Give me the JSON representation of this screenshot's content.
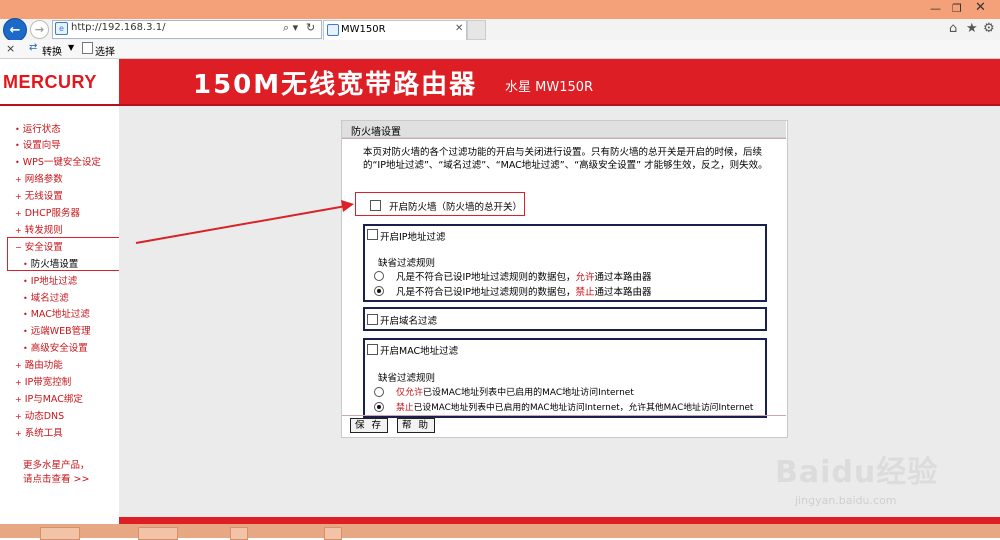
{
  "browser": {
    "url": "http://192.168.3.1/",
    "tab_title": "MW150R",
    "toolbar": {
      "close_glyph": "×",
      "convert_label": "转换",
      "select_label": "选择"
    },
    "icons": [
      "back-arrow-icon",
      "forward-arrow-icon",
      "search-icon",
      "refresh-icon",
      "home-icon",
      "star-icon",
      "gear-icon"
    ]
  },
  "header": {
    "logo": "MERCURY",
    "product_title": "150M无线宽带路由器",
    "model": "水星 MW150R"
  },
  "sidebar": {
    "items": [
      {
        "label": "运行状态",
        "bullet": "•"
      },
      {
        "label": "设置向导",
        "bullet": "•"
      },
      {
        "label": "WPS一键安全设定",
        "bullet": "•"
      },
      {
        "label": "网络参数",
        "bullet": "+"
      },
      {
        "label": "无线设置",
        "bullet": "+"
      },
      {
        "label": "DHCP服务器",
        "bullet": "+"
      },
      {
        "label": "转发规则",
        "bullet": "+"
      },
      {
        "label": "安全设置",
        "bullet": "−"
      },
      {
        "label": "防火墙设置",
        "bullet": "•"
      },
      {
        "label": "IP地址过滤",
        "bullet": "•"
      },
      {
        "label": "域名过滤",
        "bullet": "•"
      },
      {
        "label": "MAC地址过滤",
        "bullet": "•"
      },
      {
        "label": "远端WEB管理",
        "bullet": "•"
      },
      {
        "label": "高级安全设置",
        "bullet": "•"
      },
      {
        "label": "路由功能",
        "bullet": "+"
      },
      {
        "label": "IP带宽控制",
        "bullet": "+"
      },
      {
        "label": "IP与MAC绑定",
        "bullet": "+"
      },
      {
        "label": "动态DNS",
        "bullet": "+"
      },
      {
        "label": "系统工具",
        "bullet": "+"
      }
    ],
    "more_line1": "更多水星产品，",
    "more_line2": "请点击查看 >>"
  },
  "panel": {
    "title": "防火墙设置",
    "intro": "本页对防火墙的各个过滤功能的开启与关闭进行设置。只有防火墙的总开关是开启的时候，后续的“IP地址过滤”、“域名过滤”、“MAC地址过滤”、“高级安全设置” 才能够生效，反之，则失效。",
    "firewall_master": {
      "label": "开启防火墙（防火墙的总开关）",
      "checked": false
    },
    "ip_filter": {
      "enable_label": "开启IP地址过滤",
      "checked": false,
      "default_rule_label": "缺省过滤规则",
      "opt1_pre": "凡是不符合已设IP地址过滤规则的数据包，",
      "opt1_hl": "允许",
      "opt1_post": "通过本路由器",
      "opt2_pre": "凡是不符合已设IP地址过滤规则的数据包，",
      "opt2_hl": "禁止",
      "opt2_post": "通过本路由器",
      "selected": 2
    },
    "domain_filter": {
      "enable_label": "开启域名过滤",
      "checked": false
    },
    "mac_filter": {
      "enable_label": "开启MAC地址过滤",
      "checked": false,
      "default_rule_label": "缺省过滤规则",
      "opt1_hl": "仅允许",
      "opt1_post": "已设MAC地址列表中已启用的MAC地址访问Internet",
      "opt2_hl": "禁止",
      "opt2_post": "已设MAC地址列表中已启用的MAC地址访问Internet，允许其他MAC地址访问Internet",
      "selected": 2
    },
    "save_label": "保 存",
    "help_label": "帮 助"
  },
  "watermark": {
    "main": "Baidu经验",
    "sub": "jingyan.baidu.com"
  },
  "colors": {
    "brand_red": "#dd1e25",
    "annotation_red": "#d9232a",
    "group_border": "#1a1f4c",
    "page_gray": "#ebebeb"
  }
}
